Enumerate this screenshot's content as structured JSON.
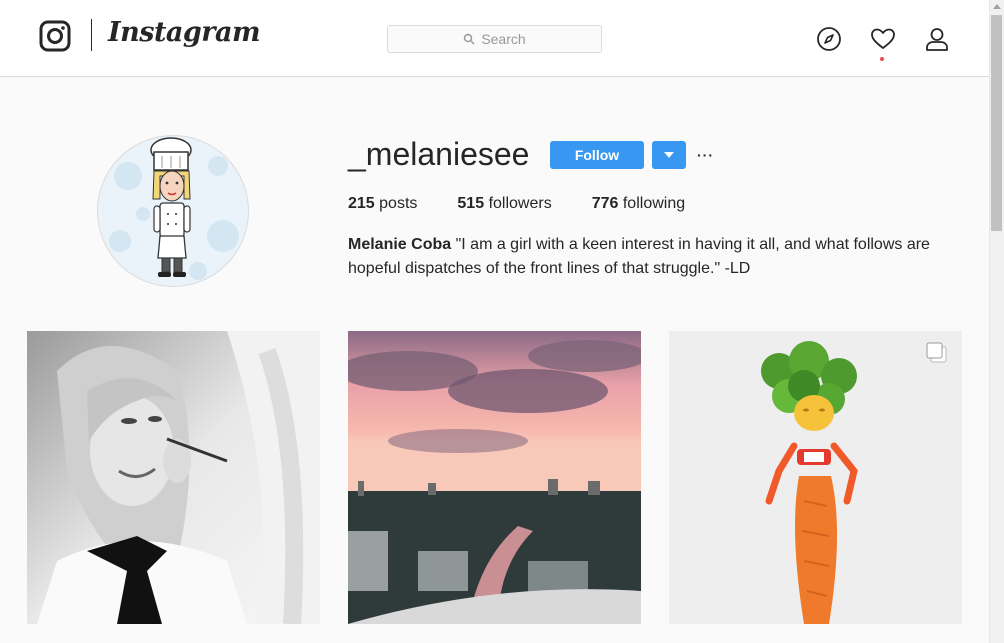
{
  "header": {
    "brand": "Instagram",
    "search_placeholder": "Search",
    "icons": [
      "instagram-glyph-icon",
      "search-icon",
      "compass-icon",
      "heart-icon",
      "person-icon"
    ]
  },
  "profile": {
    "username": "_melaniesee",
    "follow_label": "Follow",
    "more_label": "···",
    "stats": {
      "posts_count": "215",
      "posts_label": "posts",
      "followers_count": "515",
      "followers_label": "followers",
      "following_count": "776",
      "following_label": "following"
    },
    "full_name": "Melanie Coba",
    "bio": "\"I am a girl with a keen interest in having it all, and what follows are hopeful dispatches of the front lines of that struggle.\" -LD"
  },
  "posts": [
    {
      "name": "post-portrait",
      "multiple": false
    },
    {
      "name": "post-sunset-city",
      "multiple": false
    },
    {
      "name": "post-vegetable-figure",
      "multiple": true
    }
  ],
  "colors": {
    "accent": "#3897f0",
    "notification": "#ed4956",
    "border": "#dbdbdb",
    "background": "#fafafa"
  }
}
